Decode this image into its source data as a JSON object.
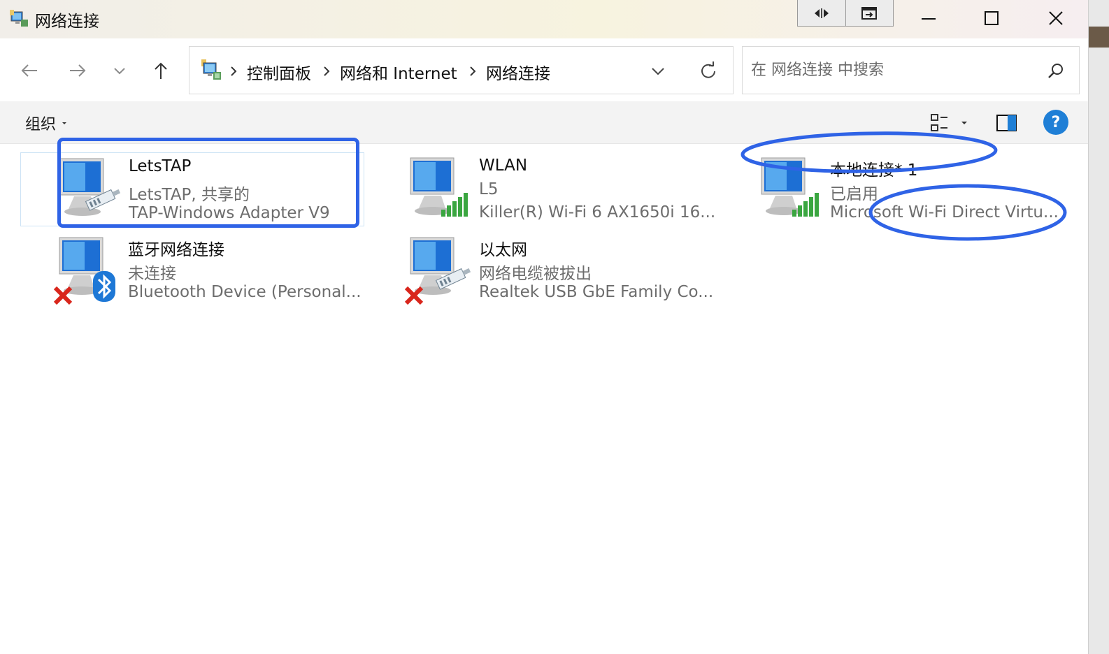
{
  "window": {
    "title": "网络连接"
  },
  "address_bar": {
    "crumbs": [
      "控制面板",
      "网络和 Internet",
      "网络连接"
    ]
  },
  "search": {
    "placeholder": "在 网络连接 中搜索"
  },
  "command_bar": {
    "organize_label": "组织",
    "help_label": "?"
  },
  "connections": [
    {
      "name": "LetsTAP",
      "status": "LetsTAP, 共享的",
      "device": "TAP-Windows Adapter V9",
      "icon": "cable-adapter-icon",
      "selected": true
    },
    {
      "name": "WLAN",
      "status": "L5",
      "device": "Killer(R) Wi-Fi 6 AX1650i 16...",
      "icon": "wifi-signal-icon"
    },
    {
      "name": "本地连接* 1",
      "status": "已启用",
      "device": "Microsoft Wi-Fi Direct Virtu...",
      "icon": "wifi-signal-icon"
    },
    {
      "name": "蓝牙网络连接",
      "status": "未连接",
      "device": "Bluetooth Device (Personal...",
      "icon": "bluetooth-icon",
      "disconnected": true
    },
    {
      "name": "以太网",
      "status": "网络电缆被拔出",
      "device": "Realtek USB GbE Family Co...",
      "icon": "cable-adapter-icon",
      "disconnected": true
    }
  ],
  "colors": {
    "annotation_blue": "#2f63e6",
    "help_blue": "#1f7fd6",
    "signal_green": "#3aa640",
    "error_red": "#d9261c"
  }
}
